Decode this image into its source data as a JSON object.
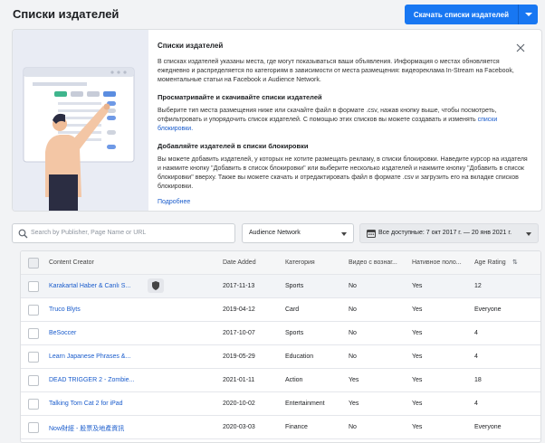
{
  "header": {
    "title": "Списки издателей",
    "download_button": "Скачать списки издателей"
  },
  "info": {
    "title": "Списки издателей",
    "p1": "В списках издателей указаны места, где могут показываться ваши объявления. Информация о местах обновляется ежедневно и распределяется по категориям в зависимости от места размещения: видеореклама In-Stream на Facebook, моментальные статьи на Facebook и Audience Network.",
    "h2": "Просматривайте и скачивайте списки издателей",
    "p2": "Выберите тип места размещения ниже или скачайте файл в формате .csv, нажав кнопку выше, чтобы посмотреть, отфильтровать и упорядочить список издателей. С помощью этих списков вы можете создавать и изменять",
    "p2_link": "списки блокировки.",
    "h3": "Добавляйте издателей в списки блокировки",
    "p3": "Вы можете добавить издателей, у которых не хотите размещать рекламу, в списки блокировки. Наведите курсор на издателя и нажмите кнопку \"Добавить в список блокировки\" или выберите несколько издателей и нажмите кнопку \"Добавить в список блокировки\" вверху. Также вы можете скачать и отредактировать файл в формате .csv и загрузить его на вкладке списков блокировки.",
    "more_link": "Подробнее"
  },
  "filters": {
    "search_placeholder": "Search by Publisher, Page Name or URL",
    "placement": "Audience Network",
    "date_range": "Все доступные: 7 окт 2017 г. — 20 янв 2021 г."
  },
  "table": {
    "columns": [
      "Content Creator",
      "Date Added",
      "Категория",
      "Видео с вознаг...",
      "Нативное поло...",
      "Age Rating"
    ],
    "rows": [
      [
        "Karakartal Haber & Canlı S...",
        "2017-11-13",
        "Sports",
        "No",
        "Yes",
        "12"
      ],
      [
        "Truco Blyts",
        "2019-04-12",
        "Card",
        "No",
        "Yes",
        "Everyone"
      ],
      [
        "BeSoccer",
        "2017-10-07",
        "Sports",
        "No",
        "Yes",
        "4"
      ],
      [
        "Learn Japanese Phrases &...",
        "2019-05-29",
        "Education",
        "No",
        "Yes",
        "4"
      ],
      [
        "DEAD TRIGGER 2 - Zombie...",
        "2021-01-11",
        "Action",
        "Yes",
        "Yes",
        "18"
      ],
      [
        "Talking Tom Cat 2 for iPad",
        "2020-10-02",
        "Entertainment",
        "Yes",
        "Yes",
        "4"
      ],
      [
        "Now財經 - 股票及地產資訊",
        "2020-03-03",
        "Finance",
        "No",
        "Yes",
        "Everyone"
      ]
    ]
  }
}
